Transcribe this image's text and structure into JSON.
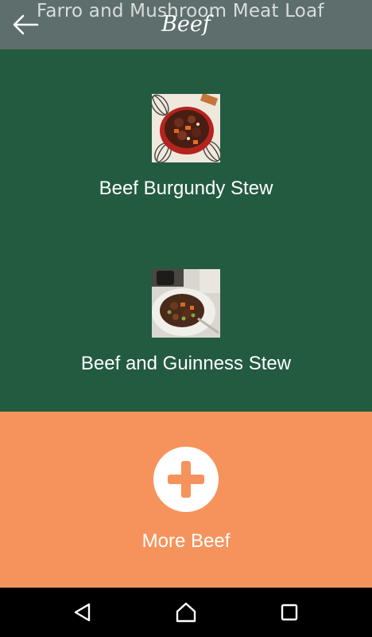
{
  "header": {
    "background_title": "Farro and Mushroom Meat Loaf",
    "category_title": "Beef",
    "back_icon": "arrow-left-icon"
  },
  "recipes": [
    {
      "label": "Beef Burgundy Stew",
      "image": "beef-burgundy-stew-photo"
    },
    {
      "label": "Beef and Guinness Stew",
      "image": "beef-guinness-stew-photo"
    }
  ],
  "more": {
    "label": "More Beef",
    "icon": "plus-icon"
  },
  "navbar": {
    "back_icon": "nav-back-icon",
    "home_icon": "nav-home-icon",
    "recents_icon": "nav-recents-icon"
  },
  "colors": {
    "header_bg": "#5e6e6d",
    "list_bg": "#235b40",
    "more_bg": "#f6935c",
    "text": "#ffffff"
  }
}
